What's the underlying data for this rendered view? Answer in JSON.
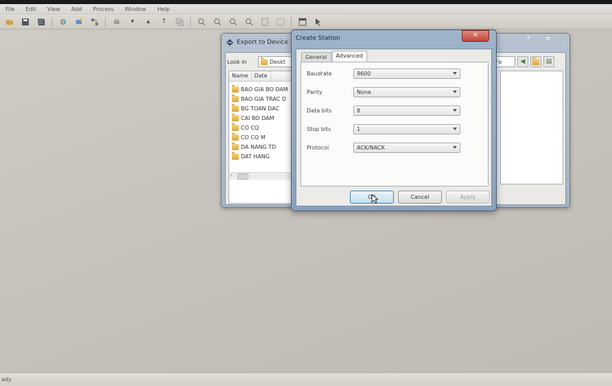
{
  "menu": [
    "File",
    "Edit",
    "View",
    "Add",
    "Process",
    "Window",
    "Help"
  ],
  "status_text": "ady",
  "export_dialog": {
    "title": "Export to Device",
    "help": "?",
    "close": "✕",
    "look_in_label": "Look in",
    "look_in_value": "Deskt",
    "view_combo": "Fo",
    "columns": [
      "Name",
      "Date"
    ],
    "files": [
      "BAO GIA BO DAM",
      "BAO GIA TRAC D",
      "BG TOAN DAC",
      "CAI BO DAM",
      "CO CQ",
      "CO CQ M",
      "DA NANG TD",
      "DAT HANG"
    ],
    "scroll_left": "‹"
  },
  "station_dialog": {
    "title": "Create Station",
    "close": "✕",
    "tabs": [
      "General",
      "Advanced"
    ],
    "active_tab": "Advanced",
    "fields": [
      {
        "label": "Baudrate",
        "value": "9600"
      },
      {
        "label": "Parity",
        "value": "None"
      },
      {
        "label": "Data bits",
        "value": "8"
      },
      {
        "label": "Stop bits",
        "value": "1"
      },
      {
        "label": "Protocol",
        "value": "ACK/NACK"
      }
    ],
    "buttons": {
      "ok": "OK",
      "cancel": "Cancel",
      "apply": "Apply"
    }
  },
  "colors": {
    "titlebar_active": "#8aa1bb",
    "close_button": "#c2473a",
    "folder": "#d8a63d"
  }
}
